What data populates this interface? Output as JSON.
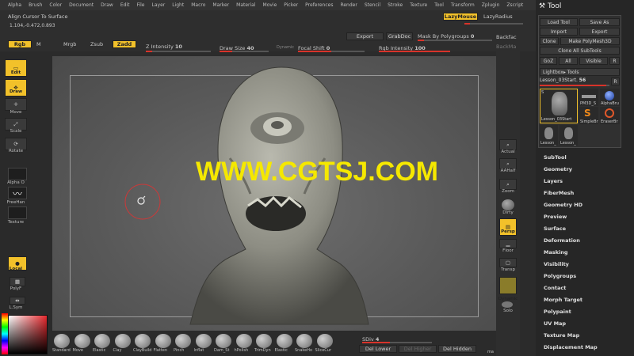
{
  "menu": [
    "Alpha",
    "Brush",
    "Color",
    "Document",
    "Draw",
    "Edit",
    "File",
    "Layer",
    "Light",
    "Macro",
    "Marker",
    "Material",
    "Movie",
    "Picker",
    "Preferences",
    "Render",
    "Stencil",
    "Stroke",
    "Texture",
    "Tool",
    "Transform",
    "Zplugin",
    "Zscript"
  ],
  "top": {
    "align_cursor": "Align Cursor To Surface",
    "coords": "1.104,-0.472,0.893",
    "lazymouse": "LazyMouse",
    "lazyradius": "LazyRadius",
    "rgb": "Rgb",
    "m": "M",
    "mrgb": "Mrgb",
    "zsub": "Zsub",
    "zadd": "Zadd",
    "z_intensity": "Z Intensity",
    "z_intensity_val": "10",
    "draw_size": "Draw Size",
    "draw_size_val": "40",
    "dynamic": "Dynamic",
    "focal_shift": "Focal Shift",
    "focal_shift_val": "0",
    "rgb_intensity": "Rgb Intensity",
    "rgb_intensity_val": "100",
    "export": "Export",
    "grabdoc": "GrabDoc",
    "mask_polygroups": "Mask By Polygroups",
    "mask_polygroups_val": "0",
    "backface": "Backfac",
    "backmask": "BackMa"
  },
  "left": {
    "edit": "Edit",
    "draw": "Draw",
    "move": "Move",
    "scale": "Scale",
    "rotate": "Rotate",
    "alpha": "Alpha O",
    "freehand": "FreeHan",
    "texture": "Texture",
    "local": "Local",
    "polyf": "PolyF",
    "lsym": "L.Sym"
  },
  "right": {
    "actual": "Actual",
    "aahalf": "AAHalf",
    "zoom": "Zoom",
    "dirty": "Dirty",
    "persp": "Persp",
    "floor": "Floor",
    "transp": "Transp",
    "dynamic": "Dynamic",
    "solo": "Solo"
  },
  "watermark": "WWW.CGTSJ.COM",
  "tool": {
    "title": "Tool",
    "load_tool": "Load Tool",
    "save_as": "Save As",
    "import": "Import",
    "export": "Export",
    "clone": "Clone",
    "make_polymesh": "Make PolyMesh3D",
    "clone_all": "Clone All SubTools",
    "goz": "GoZ",
    "all": "All",
    "visible": "Visible",
    "r": "R",
    "lightbox": "Lightbox▸ Tools",
    "current": "Lesson_03Start.",
    "current_val": "56",
    "thumbs": [
      "Lesson_03Start",
      "PM3D_S",
      "AlphaBru",
      "SimpleBr",
      "EraserBr",
      "Lesson_",
      "Lesson_"
    ],
    "s_label": "S",
    "menu": [
      "SubTool",
      "Geometry",
      "Layers",
      "FiberMesh",
      "Geometry HD",
      "Preview",
      "Surface",
      "Deformation",
      "Masking",
      "Visibility",
      "Polygroups",
      "Contact",
      "Morph Target",
      "Polypaint",
      "UV Map",
      "Texture Map",
      "Displacement Map"
    ]
  },
  "bottom": {
    "brushes": [
      "Standard",
      "Move",
      "Elastic",
      "Clay",
      "ClayBuild",
      "Flatten",
      "Pinch",
      "Inflat",
      "Dam_St",
      "hPolish",
      "TrimDyn",
      "Elastic",
      "SnakeHo",
      "SliceCur"
    ],
    "sdiv": "SDiv",
    "sdiv_val": "4",
    "del_lower": "Del Lower",
    "del_higher": "Del Higher",
    "del_hidden": "Del Hidden",
    "ma": "ma"
  },
  "colors": {
    "accent": "#f2c12a",
    "slider": "#d8332a",
    "watermark": "#f5e800"
  }
}
